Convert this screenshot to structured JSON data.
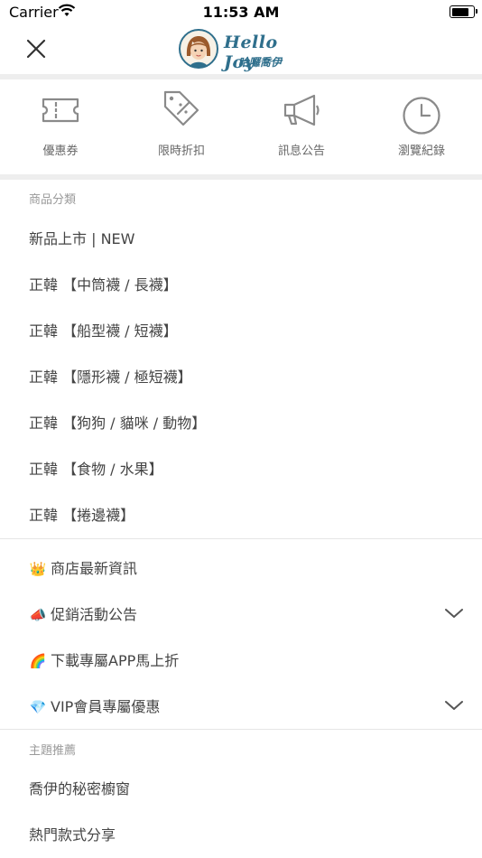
{
  "status_bar": {
    "carrier": "Carrier",
    "time": "11:53 AM"
  },
  "header": {
    "logo_title": "Hello Joy",
    "logo_subtitle": "哈囉喬伊"
  },
  "quick_links": [
    {
      "label": "優惠券",
      "icon": "ticket-icon"
    },
    {
      "label": "限時折扣",
      "icon": "discount-tag-icon"
    },
    {
      "label": "訊息公告",
      "icon": "megaphone-icon"
    },
    {
      "label": "瀏覽紀錄",
      "icon": "clock-icon"
    }
  ],
  "categories": {
    "title": "商品分類",
    "items": [
      "新品上市 | NEW",
      "正韓 【中筒襪 / 長襪】",
      "正韓 【船型襪 / 短襪】",
      "正韓 【隱形襪 / 極短襪】",
      "正韓 【狗狗 / 貓咪 / 動物】",
      "正韓 【食物 / 水果】",
      "正韓 【捲邊襪】"
    ]
  },
  "promos": {
    "items": [
      {
        "emoji": "👑",
        "label": "商店最新資訊",
        "expandable": false
      },
      {
        "emoji": "📣",
        "label": "促銷活動公告",
        "expandable": true
      },
      {
        "emoji": "🌈",
        "label": "下載專屬APP馬上折",
        "expandable": false
      },
      {
        "emoji": "💎",
        "label": "VIP會員專屬優惠",
        "expandable": true
      }
    ]
  },
  "themes": {
    "title": "主題推薦",
    "items": [
      "喬伊的秘密櫥窗",
      "熱門款式分享"
    ]
  }
}
